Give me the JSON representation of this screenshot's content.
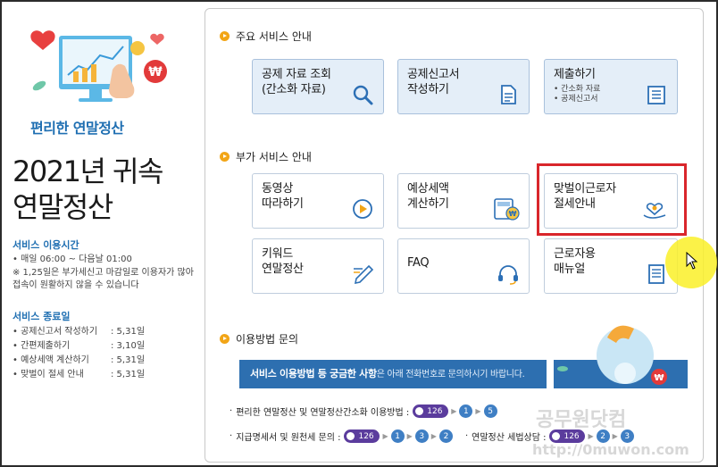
{
  "left": {
    "tagline": "편리한 연말정산",
    "title": "2021년 귀속\n연말정산",
    "service_hours": {
      "heading": "서비스 이용시간",
      "line1": "• 매일 06:00 ~ 다음날 01:00",
      "note": "※ 1,25일은 부가세신고 마감일로 이용자가 많아 접속이 원활하지 않을 수 있습니다"
    },
    "end_date": {
      "heading": "서비스 종료일",
      "items": [
        {
          "label": "• 공제신고서 작성하기",
          "value": ": 5,31일"
        },
        {
          "label": "• 간편제출하기",
          "value": ": 3,10일"
        },
        {
          "label": "• 예상세액 계산하기",
          "value": ": 5,31일"
        },
        {
          "label": "• 맞벌이 절세 안내",
          "value": ": 5,31일"
        }
      ]
    }
  },
  "main_services": {
    "heading": "주요 서비스 안내",
    "cards": [
      {
        "label": "공제 자료 조회\n(간소화 자료)",
        "icon": "magnifier-icon"
      },
      {
        "label": "공제신고서\n작성하기",
        "icon": "document-icon"
      },
      {
        "label": "제출하기",
        "sub1": "• 간소화 자료",
        "sub2": "• 공제신고서",
        "icon": "submit-tray-icon"
      }
    ]
  },
  "extra_services": {
    "heading": "부가 서비스 안내",
    "cards": [
      {
        "label": "동영상\n따라하기",
        "icon": "play-icon"
      },
      {
        "label": "예상세액\n계산하기",
        "icon": "calculator-icon"
      },
      {
        "label": "맞벌이근로자\n절세안내",
        "icon": "heart-hand-icon"
      },
      {
        "label": "키워드\n연말정산",
        "icon": "pencil-icon"
      },
      {
        "label": "FAQ",
        "icon": "headset-icon"
      },
      {
        "label": "근로자용\n매뉴얼",
        "icon": "manual-icon"
      }
    ]
  },
  "inquiry": {
    "heading": "이용방법 문의",
    "banner_bold": "서비스 이용방법 등 궁금한 사항",
    "banner_rest": "은 아래 전화번호로 문의하시기 바랍니다.",
    "line1_label": "편리한 연말정산 및 연말정산간소화 이용방법 :",
    "line1_phone": "126",
    "line1_steps": [
      "1",
      "5"
    ],
    "line2_label": "지급명세서 및 원천세 문의 :",
    "line2_phone": "126",
    "line2_steps": [
      "1",
      "3",
      "2"
    ],
    "line3_label": "연말정산 세법상담 :",
    "line3_phone": "126",
    "line3_steps": [
      "2",
      "3"
    ]
  },
  "watermark": {
    "text1": "공무원닷컴",
    "text2": "http://0muwon.com"
  },
  "colors": {
    "accent": "#1f6fb2",
    "highlight": "#d9262b",
    "card_blue": "#e4eef8",
    "bullet": "#f2a516",
    "banner": "#2d6fb0"
  }
}
